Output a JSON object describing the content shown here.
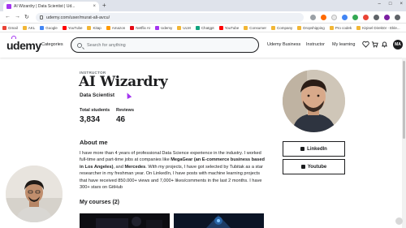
{
  "browser": {
    "tab_title": "AI Wizardry | Data Scientist | Ud...",
    "tab_close": "×",
    "new_tab": "+",
    "window_controls": [
      "–",
      "□",
      "×"
    ],
    "url": "udemy.com/user/murat-ali-avcu/",
    "nav": {
      "back": "←",
      "forward": "→",
      "reload": "↻"
    },
    "bookmarks": [
      "Gmail",
      "AKL",
      "Google",
      "YouTube",
      "Kitap",
      "Amazon",
      "Netflix AI",
      "Udemy",
      "ULM",
      "Chatgpt",
      "YouTube",
      "Consumer",
      "Company",
      "Dropshipping",
      "Pro codek",
      "Kişisel Direktör - Ekle..."
    ],
    "bookmark_colors": [
      "#ea4335",
      "#f2b634",
      "#4285f4",
      "#ff0000",
      "#f2b634",
      "#ff9900",
      "#e50914",
      "#a435f0",
      "#f2b634",
      "#10a37f",
      "#ff0000",
      "#f2b634",
      "#f2b634",
      "#f2b634",
      "#f2b634",
      "#f2b634"
    ]
  },
  "header": {
    "logo": "udemy",
    "categories": "Categories",
    "search_placeholder": "Search for anything",
    "udemy_business": "Udemy Business",
    "instructor": "Instructor",
    "my_learning": "My learning",
    "avatar_initials": "MA"
  },
  "profile": {
    "role_label": "INSTRUCTOR",
    "name": "AI Wizardry",
    "headline": "Data Scientist",
    "total_students_label": "Total students",
    "total_students": "3,834",
    "reviews_label": "Reviews",
    "reviews": "46",
    "about_heading": "About me",
    "about_p1": "I have more than 4 years of professional Data Science experience in the industry. I worked full-time and part-time jobs at companies like ",
    "about_b1": "MegaGear (an E-commerce business based in Los Angeles)",
    "about_p2": ", and ",
    "about_b2": "Mercedes",
    "about_p3": ". With my projects, I have got selected by Tubitak as a star researcher in my freshman year. On LinkedIn, I have posts with machine learning projects that have received 850.000+ views and 7,000+ likes/comments in the last 2 months. I have 300+ stars on GitHub",
    "courses_heading": "My courses (2)"
  },
  "social": {
    "linkedin": "LinkedIn",
    "youtube": "Youtube"
  },
  "colors": {
    "accent": "#a435f0",
    "text": "#1c1d1f",
    "muted": "#6a6f73"
  }
}
